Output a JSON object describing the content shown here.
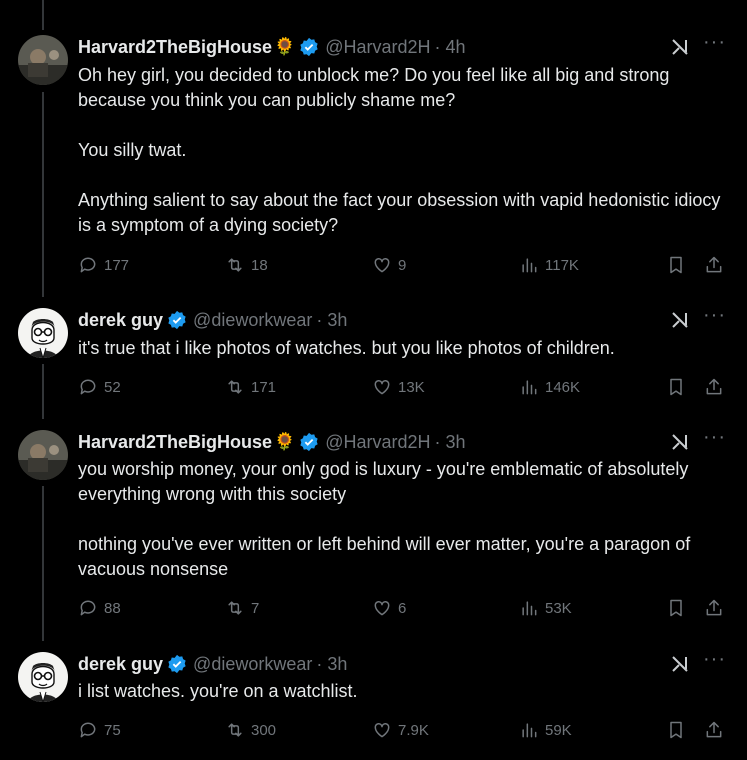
{
  "colors": {
    "background": "#000000",
    "text": "#e7e9ea",
    "muted": "#71767b",
    "verified": "#1d9bf0",
    "thread_line": "#333639"
  },
  "tweets": [
    {
      "name": "Harvard2TheBigHouse",
      "emoji": "🌻",
      "handle": "@Harvard2H",
      "time": "· 4h",
      "text": "Oh hey girl, you decided to unblock me? Do you feel like all big and strong because you think you can publicly shame me?\n\nYou silly twat.\n\nAnything salient to say about the fact your obsession with vapid hedonistic idiocy is a symptom of a dying society?",
      "replies": "177",
      "retweets": "18",
      "likes": "9",
      "views": "117K",
      "avatar": "photo-avatar"
    },
    {
      "name": "derek guy",
      "emoji": "",
      "handle": "@dieworkwear",
      "time": "· 3h",
      "text": "it's true that i like photos of watches. but you like photos of children.",
      "replies": "52",
      "retweets": "171",
      "likes": "13K",
      "views": "146K",
      "avatar": "cartoon-avatar"
    },
    {
      "name": "Harvard2TheBigHouse",
      "emoji": "🌻",
      "handle": "@Harvard2H",
      "time": "· 3h",
      "text": "you worship money, your only god is luxury - you're emblematic of absolutely everything wrong with this society\n\nnothing you've ever written or left behind will ever matter, you're a paragon of vacuous nonsense",
      "replies": "88",
      "retweets": "7",
      "likes": "6",
      "views": "53K",
      "avatar": "photo-avatar"
    },
    {
      "name": "derek guy",
      "emoji": "",
      "handle": "@dieworkwear",
      "time": "· 3h",
      "text": "i list watches. you're on a watchlist.",
      "replies": "75",
      "retweets": "300",
      "likes": "7.9K",
      "views": "59K",
      "avatar": "cartoon-avatar"
    }
  ]
}
